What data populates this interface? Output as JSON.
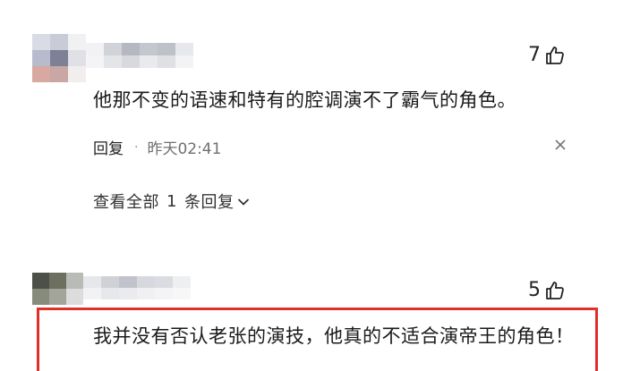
{
  "comments": [
    {
      "likes": "7",
      "text": "他那不变的语速和特有的腔调演不了霸气的角色。",
      "reply_label": "回复",
      "separator": "·",
      "time": "昨天02:41",
      "view_replies": {
        "prefix": "查看全部",
        "count": "1",
        "suffix": "条回复"
      }
    },
    {
      "likes": "5",
      "text": "我并没有否认老张的演技，他真的不适合演帝王的角色！"
    }
  ],
  "icons": {
    "like": "thumbs-up-icon",
    "more": "more-options-icon",
    "expand": "chevron-down-icon"
  },
  "colors": {
    "highlight": "#e12f2a"
  }
}
